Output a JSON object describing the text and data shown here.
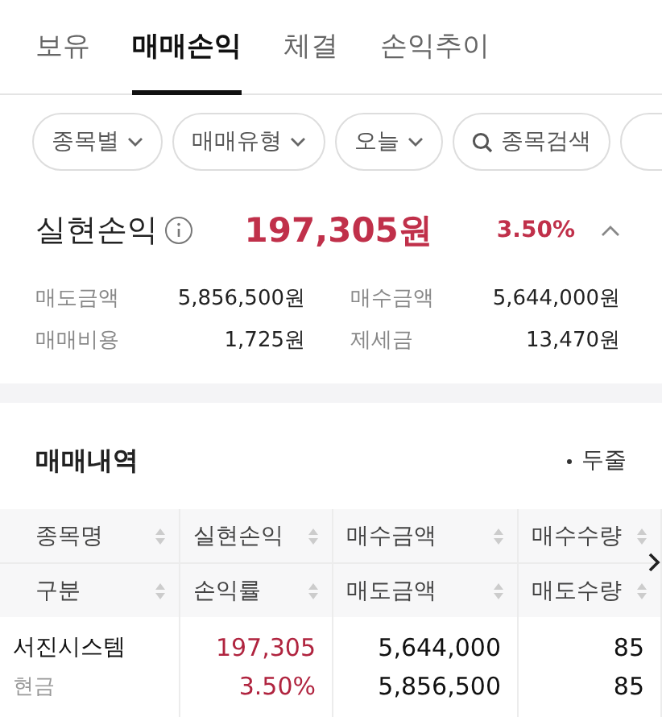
{
  "tabs": [
    {
      "label": "보유",
      "selected": false
    },
    {
      "label": "매매손익",
      "selected": true
    },
    {
      "label": "체결",
      "selected": false
    },
    {
      "label": "손익추이",
      "selected": false
    }
  ],
  "filters": [
    {
      "kind": "dropdown",
      "label": "종목별"
    },
    {
      "kind": "dropdown",
      "label": "매매유형"
    },
    {
      "kind": "dropdown",
      "label": "오늘"
    },
    {
      "kind": "search",
      "label": "종목검색"
    }
  ],
  "summary": {
    "title": "실현손익",
    "amount": "197,305원",
    "rate": "3.50%",
    "expanded": true,
    "items": [
      {
        "label": "매도금액",
        "value": "5,856,500원"
      },
      {
        "label": "매수금액",
        "value": "5,644,000원"
      },
      {
        "label": "매매비용",
        "value": "1,725원"
      },
      {
        "label": "제세금",
        "value": "13,470원"
      }
    ]
  },
  "history": {
    "title": "매매내역",
    "view_toggle": "두줄",
    "header_rows": [
      [
        "종목명",
        "실현손익",
        "매수금액",
        "매수수량"
      ],
      [
        "구분",
        "손익률",
        "매도금액",
        "매도수량"
      ]
    ],
    "rows": [
      [
        "서진시스템",
        "197,305",
        "5,644,000",
        "85"
      ],
      [
        "현금",
        "3.50%",
        "5,856,500",
        "85"
      ]
    ]
  }
}
